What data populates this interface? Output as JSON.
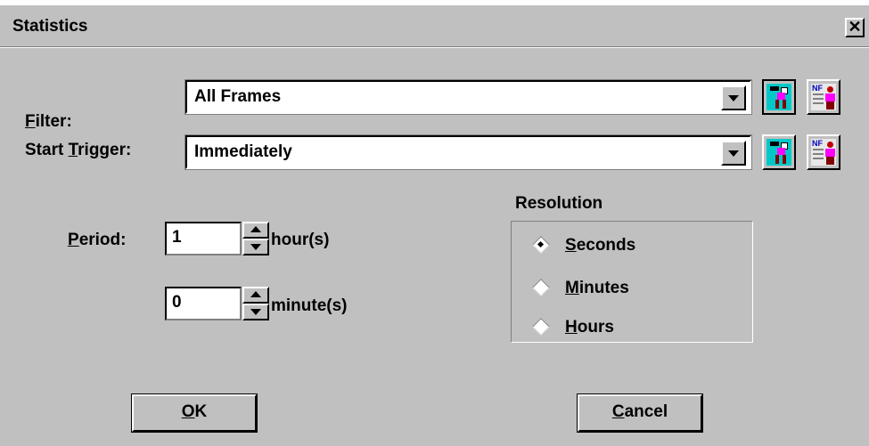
{
  "window": {
    "title": "Statistics",
    "close_glyph": "✕"
  },
  "filter": {
    "label_mnemonic": "F",
    "label_rest": "ilter:",
    "value": "All Frames",
    "icons": [
      "binoculars-person-icon",
      "nf-person-icon"
    ]
  },
  "start_trigger": {
    "label_pre": "Start ",
    "label_mnemonic": "T",
    "label_rest": "rigger:",
    "value": "Immediately",
    "icons": [
      "binoculars-person-icon",
      "nf-person-icon"
    ]
  },
  "period": {
    "label_mnemonic": "P",
    "label_rest": "eriod:",
    "hours_value": "1",
    "hours_unit": "hour(s)",
    "minutes_value": "0",
    "minutes_unit": "minute(s)"
  },
  "resolution": {
    "title": "Resolution",
    "options": [
      {
        "mnemonic": "S",
        "rest": "econds",
        "selected": true
      },
      {
        "mnemonic": "M",
        "rest": "inutes",
        "selected": false
      },
      {
        "mnemonic": "H",
        "rest": "ours",
        "selected": false
      }
    ]
  },
  "buttons": {
    "ok_mnemonic": "O",
    "ok_rest": "K",
    "cancel_mnemonic": "C",
    "cancel_rest": "ancel"
  }
}
